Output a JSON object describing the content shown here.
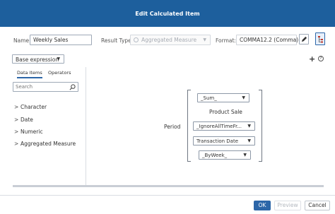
{
  "dialog": {
    "title": "Edit Calculated Item"
  },
  "header": {
    "name_label": "Name:",
    "name_value": "Weekly Sales",
    "result_type_label": "Result Type:",
    "result_type_value": "Aggregated Measure",
    "format_label": "Format:",
    "format_value": "COMMA12.2 (Comma)"
  },
  "mode": {
    "selected": "Base expression"
  },
  "tabs": [
    {
      "label": "Data Items",
      "selected": true
    },
    {
      "label": "Operators",
      "selected": false
    }
  ],
  "search": {
    "placeholder": "Search"
  },
  "tree": {
    "items": [
      {
        "label": "Character"
      },
      {
        "label": "Date"
      },
      {
        "label": "Numeric"
      },
      {
        "label": "Aggregated Measure"
      }
    ]
  },
  "expression": {
    "aggregation": "_Sum_",
    "measure": "Product Sale",
    "period_label": "Period",
    "period_function": "_IgnoreAllTimeFr...",
    "date_item": "Transaction Date",
    "interval": "_ByWeek_"
  },
  "footer": {
    "ok_label": "OK",
    "preview_label": "Preview",
    "cancel_label": "Cancel"
  },
  "colors": {
    "titlebar": "#1d5f9d",
    "accent": "#2c66a8"
  }
}
